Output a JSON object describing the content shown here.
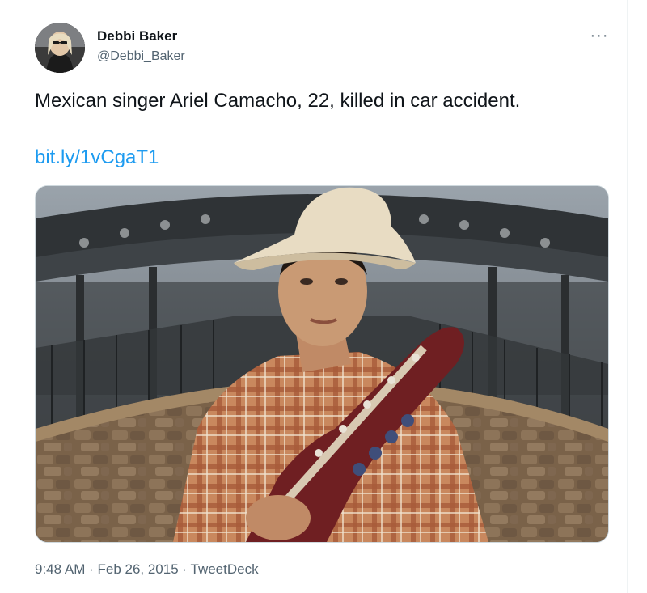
{
  "tweet": {
    "author_name": "Debbi Baker",
    "author_handle": "@Debbi_Baker",
    "more_icon": "more-horizontal-icon",
    "text": "Mexican singer Ariel Camacho, 22,  killed in car accident.",
    "link": "bit.ly/1vCgaT1",
    "time": "9:48 AM",
    "separator": " · ",
    "date": "Feb 26, 2015",
    "source": "TweetDeck"
  },
  "colors": {
    "link": "#1d9bf0",
    "secondary_text": "#536471",
    "primary_text": "#0f1419"
  }
}
